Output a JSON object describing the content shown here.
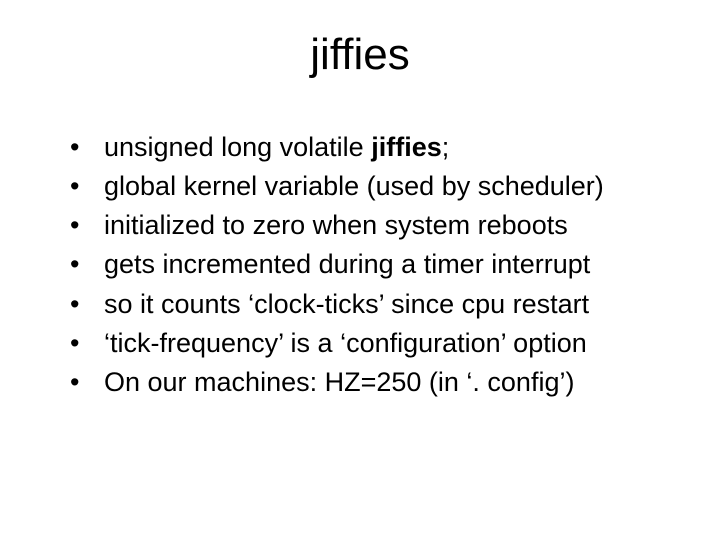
{
  "slide": {
    "title": "jiffies",
    "bullets": [
      {
        "prefix": "unsigned long volatile   ",
        "bold": "jiffies",
        "suffix": ";"
      },
      {
        "text": "global kernel variable (used by scheduler)"
      },
      {
        "text": "initialized to zero when system reboots"
      },
      {
        "text": "gets incremented during a timer interrupt"
      },
      {
        "text": "so it counts ‘clock-ticks’ since cpu restart"
      },
      {
        "text": "‘tick-frequency’ is a ‘configuration’ option"
      },
      {
        "text": "On our machines:  HZ=250   (in ‘. config’)"
      }
    ]
  }
}
